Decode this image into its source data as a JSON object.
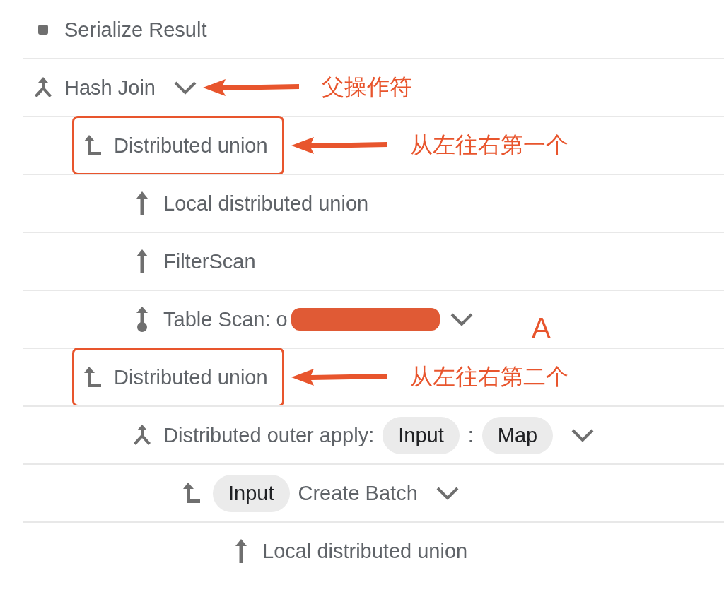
{
  "plan": [
    {
      "kind": "square",
      "parts": [
        {
          "kind": "text",
          "text": "Serialize Result"
        }
      ]
    },
    {
      "kind": "join",
      "parts": [
        {
          "kind": "text",
          "text": "Hash Join"
        }
      ],
      "expanded": true,
      "annotation": "父操作符",
      "children": [
        {
          "kind": "branch",
          "parts": [
            {
              "kind": "text",
              "text": "Distributed union"
            }
          ],
          "highlighted": true,
          "annotation": "从左往右第一个",
          "children": [
            {
              "kind": "up",
              "parts": [
                {
                  "kind": "text",
                  "text": "Local distributed union"
                }
              ]
            },
            {
              "kind": "up",
              "parts": [
                {
                  "kind": "text",
                  "text": "FilterScan"
                }
              ]
            },
            {
              "kind": "scan",
              "parts": [
                {
                  "kind": "text",
                  "text": "Table Scan: o"
                }
              ],
              "redacted": true,
              "expanded": true,
              "note": "A"
            }
          ]
        },
        {
          "kind": "branch",
          "parts": [
            {
              "kind": "text",
              "text": "Distributed union"
            }
          ],
          "highlighted": true,
          "annotation": "从左往右第二个",
          "children": [
            {
              "kind": "join",
              "parts": [
                {
                  "kind": "text",
                  "text": "Distributed outer apply:"
                },
                {
                  "kind": "chip",
                  "text": "Input"
                },
                {
                  "kind": "text",
                  "text": ":"
                },
                {
                  "kind": "chip",
                  "text": "Map"
                }
              ],
              "expanded": true,
              "children": [
                {
                  "kind": "branch",
                  "parts": [
                    {
                      "kind": "chip",
                      "text": "Input"
                    },
                    {
                      "kind": "text",
                      "text": "Create Batch"
                    }
                  ],
                  "expanded": true,
                  "children": [
                    {
                      "kind": "up",
                      "parts": [
                        {
                          "kind": "text",
                          "text": "Local distributed union"
                        }
                      ]
                    }
                  ]
                }
              ]
            }
          ]
        }
      ]
    }
  ]
}
